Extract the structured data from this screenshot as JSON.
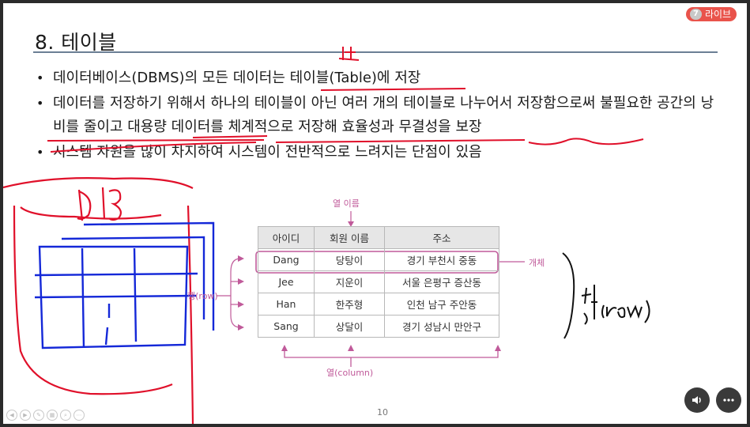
{
  "live_badge": {
    "num": "7",
    "label": "라이브"
  },
  "slide": {
    "title": "8. 테이블",
    "bullets": [
      "데이터베이스(DBMS)의 모든 데이터는 테이블(Table)에 저장",
      "데이터를 저장하기 위해서 하나의 테이블이 아닌 여러 개의 테이블로 나누어서 저장함으로써 불필요한 공간의 낭비를 줄이고 대용량 데이터를 체계적으로 저장해 효율성과 무결성을 보장",
      "시스템 자원을 많이 차지하여 시스템이 전반적으로 느려지는 단점이 있음"
    ],
    "page_number": "10"
  },
  "diagram": {
    "column_name_label": "열 이름",
    "entity_label": "개체",
    "row_label": "행(row)",
    "column_label": "열(column)",
    "headers": [
      "아이디",
      "회원 이름",
      "주소"
    ],
    "rows": [
      [
        "Dang",
        "당탕이",
        "경기 부천시 중동"
      ],
      [
        "Jee",
        "지운이",
        "서울 은평구 증산동"
      ],
      [
        "Han",
        "한주형",
        "인천 남구 주안동"
      ],
      [
        "Sang",
        "상달이",
        "경기 성남시 만안구"
      ]
    ]
  },
  "annotations": {
    "db_text": "DB",
    "row_text": "행(row)"
  },
  "colors": {
    "accent": "#c05a9a",
    "ink_red": "#e0102a",
    "ink_blue": "#1428d8",
    "live": "#e9534b"
  },
  "icons": [
    "volume-icon",
    "more-icon"
  ]
}
